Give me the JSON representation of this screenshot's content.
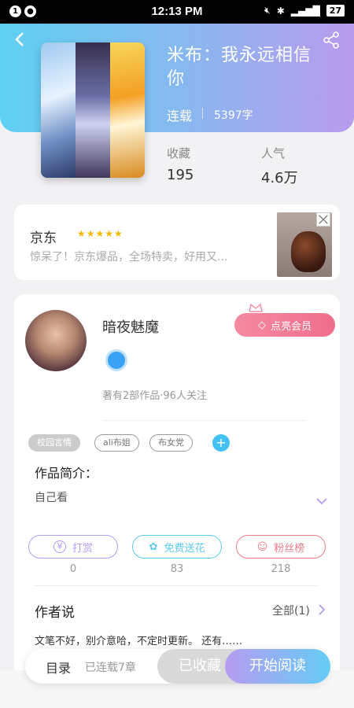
{
  "status": {
    "time": "12:13 PM",
    "notif1": "1",
    "battery": "27",
    "network": "4G"
  },
  "book": {
    "title": "米布：我永远相信你",
    "status": "连载",
    "words": "5397字",
    "stats": [
      {
        "label": "收藏",
        "value": "195"
      },
      {
        "label": "人气",
        "value": "4.6万"
      }
    ]
  },
  "ad": {
    "brand": "京东",
    "stars": "★★★★★",
    "text": "惊呆了！京东爆品，全场特卖，好用又..."
  },
  "author": {
    "name": "暗夜魅魔",
    "meta": "著有2部作品·96人关注",
    "vip_label": "点亮会员"
  },
  "tags": [
    "校园言情",
    "ali布姐",
    "布女党"
  ],
  "intro": {
    "heading": "作品简介：",
    "text": "自己看"
  },
  "actions": [
    {
      "label": "打赏",
      "count": "0",
      "color": "#b49af0",
      "icon": "coin-icon"
    },
    {
      "label": "免费送花",
      "count": "83",
      "color": "#5ccbef",
      "icon": "flower-icon"
    },
    {
      "label": "粉丝榜",
      "count": "218",
      "color": "#ef7b8b",
      "icon": "fan-icon"
    }
  ],
  "author_says": {
    "heading": "作者说",
    "all_label": "全部(1)",
    "text": "文笔不好，别介意哈，不定时更新。 还有……"
  },
  "bottom": {
    "toc_label": "目录",
    "toc_sub": "已连载7章",
    "fav_label": "已收藏",
    "read_label": "开始阅读"
  }
}
